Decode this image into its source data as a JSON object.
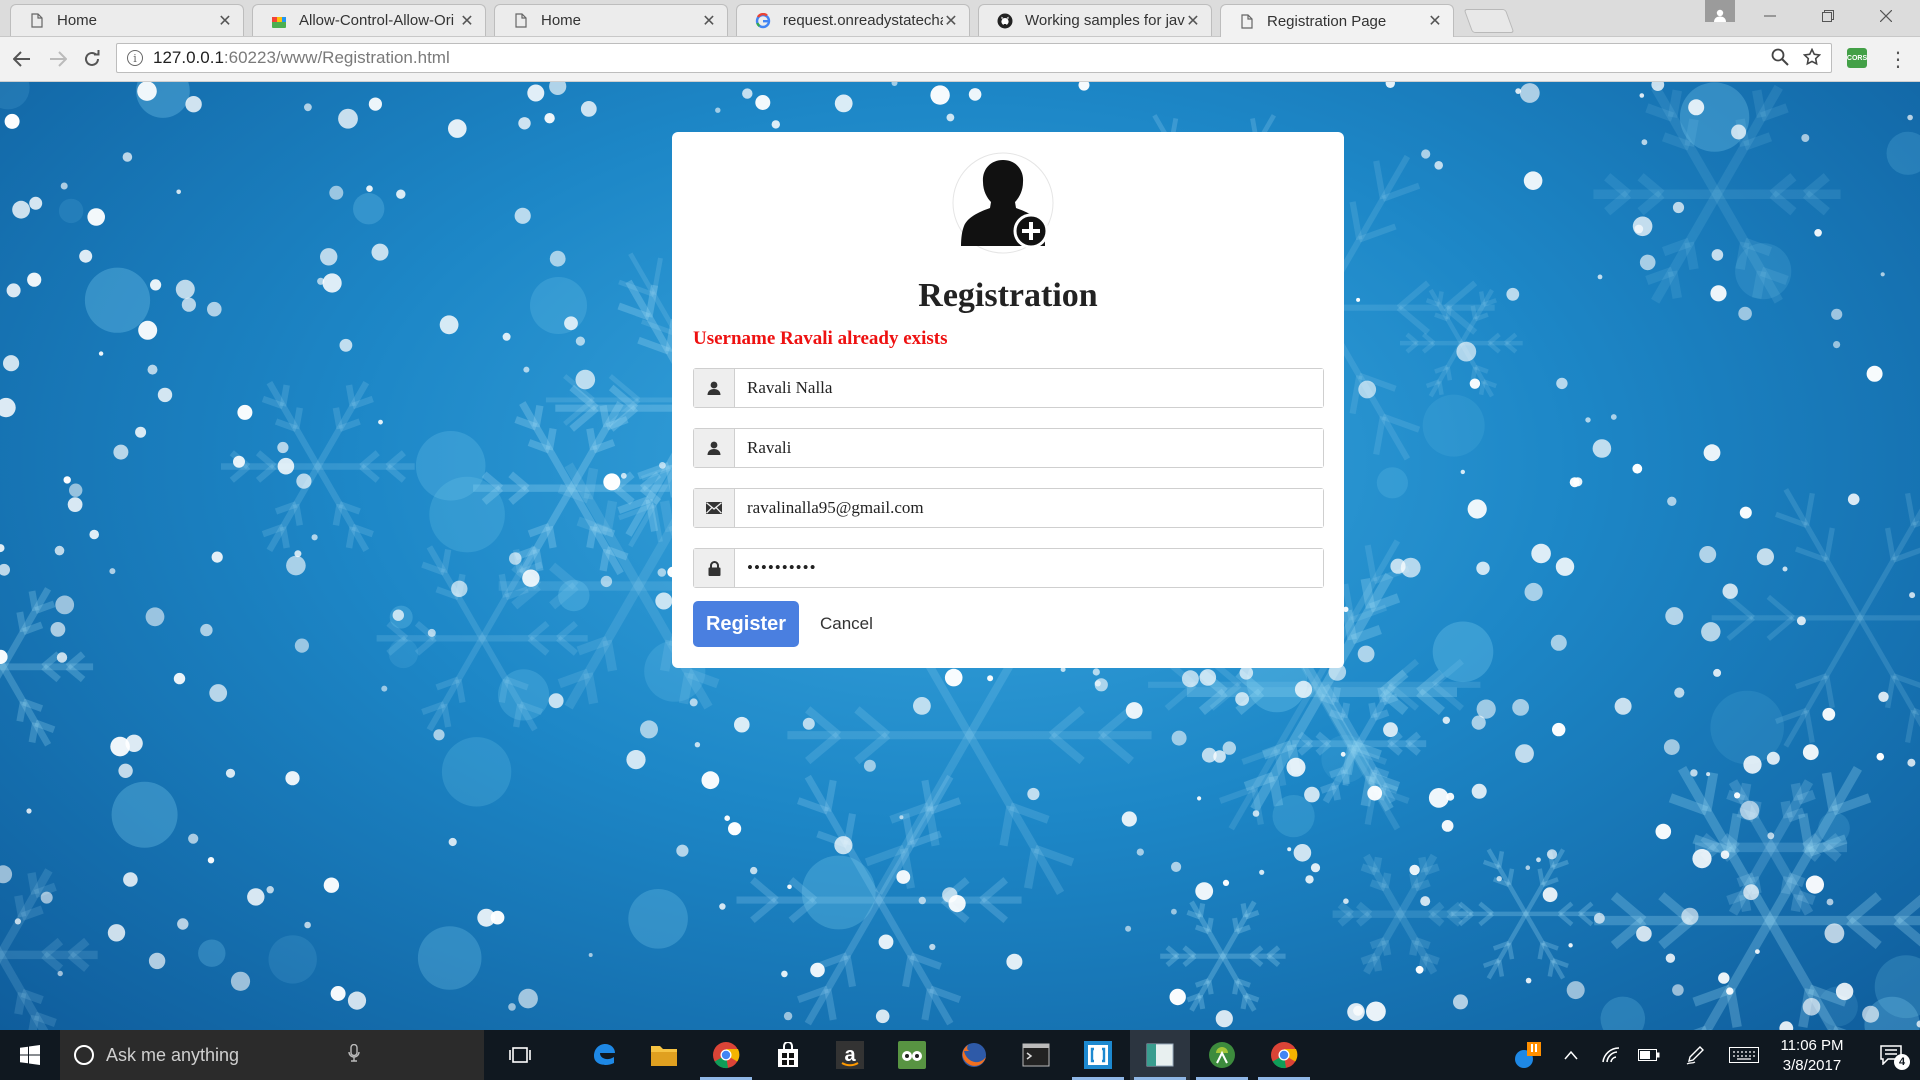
{
  "browser": {
    "tabs": [
      {
        "title": "Home",
        "icon": "page-icon",
        "active": false
      },
      {
        "title": "Allow-Control-Allow-Ori",
        "icon": "chrome-store-icon",
        "active": false
      },
      {
        "title": "Home",
        "icon": "page-icon",
        "active": false
      },
      {
        "title": "request.onreadystatecha",
        "icon": "google-icon",
        "active": false
      },
      {
        "title": "Working samples for jav",
        "icon": "github-icon",
        "active": false
      },
      {
        "title": "Registration Page",
        "icon": "page-icon",
        "active": true
      }
    ],
    "url_host": "127.0.0.1",
    "url_rest": ":60223/www/Registration.html",
    "extension_label": "CORS"
  },
  "page": {
    "heading": "Registration",
    "error_message": "Username Ravali already exists",
    "fields": {
      "fullname": {
        "value": "Ravali Nalla",
        "icon": "user-icon"
      },
      "username": {
        "value": "Ravali",
        "icon": "user-icon"
      },
      "email": {
        "value": "ravalinalla95@gmail.com",
        "icon": "envelope-icon"
      },
      "password": {
        "value": "••••••••••",
        "icon": "lock-icon"
      }
    },
    "register_label": "Register",
    "cancel_label": "Cancel",
    "accent_color": "#4a7fe0",
    "error_color": "#ee1111"
  },
  "taskbar": {
    "search_placeholder": "Ask me anything",
    "apps": [
      "edge-icon",
      "file-explorer-icon",
      "chrome-icon",
      "store-icon",
      "amazon-icon",
      "tripadvisor-icon",
      "firefox-icon",
      "terminal-icon",
      "brackets-icon",
      "app-window-icon",
      "android-studio-icon",
      "chrome-icon"
    ],
    "notification_badge": "4",
    "time": "11:06 PM",
    "date": "3/8/2017"
  }
}
